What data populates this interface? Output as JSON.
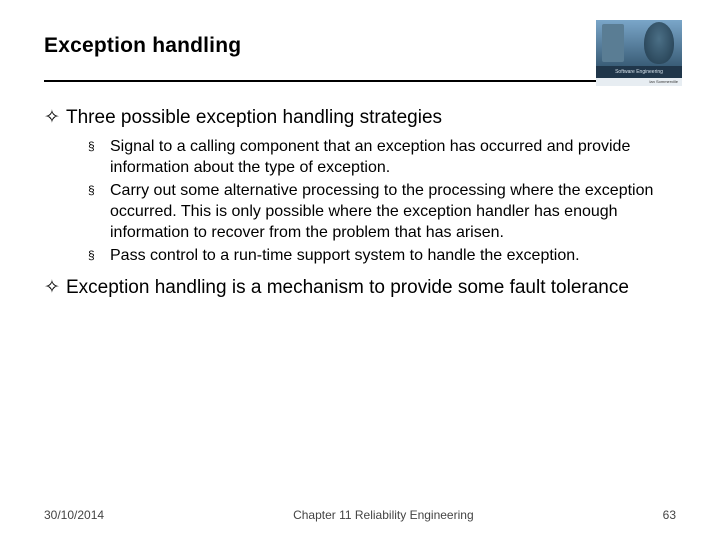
{
  "title": "Exception handling",
  "logo": {
    "strip": "Software Engineering",
    "sub": "Ian Sommerville"
  },
  "points": {
    "p1": "Three possible exception handling strategies",
    "s1": "Signal to a calling component that an exception has occurred and provide information about the type of exception.",
    "s2": "Carry out some alternative processing to the processing where the exception occurred. This is only possible where the exception handler has enough information to recover from the problem that has arisen.",
    "s3": "Pass control to a run-time support system to handle the exception.",
    "p2": "Exception handling is a mechanism to provide some fault tolerance"
  },
  "bullets": {
    "diamond": "✧",
    "square": "§"
  },
  "footer": {
    "date": "30/10/2014",
    "chapter": "Chapter 11 Reliability Engineering",
    "page": "63"
  }
}
